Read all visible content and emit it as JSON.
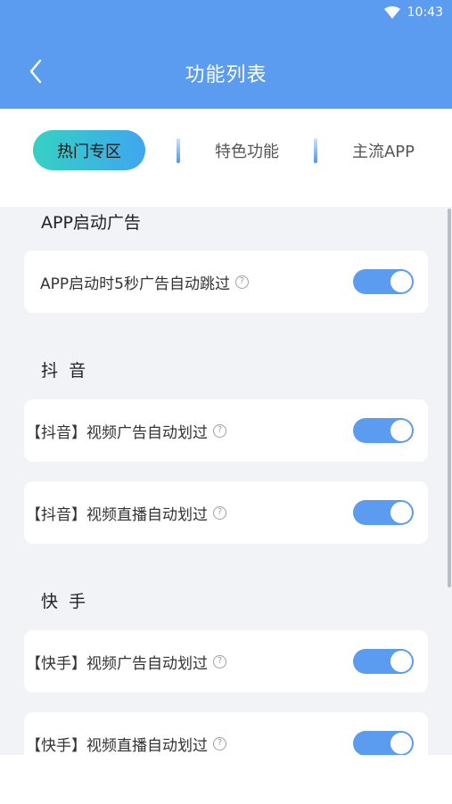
{
  "status_bar": {
    "time": "10:43"
  },
  "header": {
    "title": "功能列表"
  },
  "tabs": [
    {
      "label": "热门专区",
      "active": true
    },
    {
      "label": "特色功能",
      "active": false
    },
    {
      "label": "主流APP",
      "active": false
    }
  ],
  "sections": [
    {
      "title": "APP启动广告",
      "items": [
        {
          "label": "APP启动时5秒广告自动跳过",
          "enabled": true
        }
      ]
    },
    {
      "title": "抖  音",
      "items": [
        {
          "label": "【抖音】视频广告自动划过",
          "enabled": true
        },
        {
          "label": "【抖音】视频直播自动划过",
          "enabled": true
        }
      ]
    },
    {
      "title": "快  手",
      "items": [
        {
          "label": "【快手】视频广告自动划过",
          "enabled": true
        },
        {
          "label": "【快手】视频直播自动划过",
          "enabled": true
        }
      ]
    }
  ],
  "help_symbol": "?",
  "colors": {
    "primary": "#5b9bf0",
    "tab_gradient_start": "#35d1c2",
    "tab_gradient_end": "#3fa6f0",
    "background": "#f1f3f7"
  }
}
